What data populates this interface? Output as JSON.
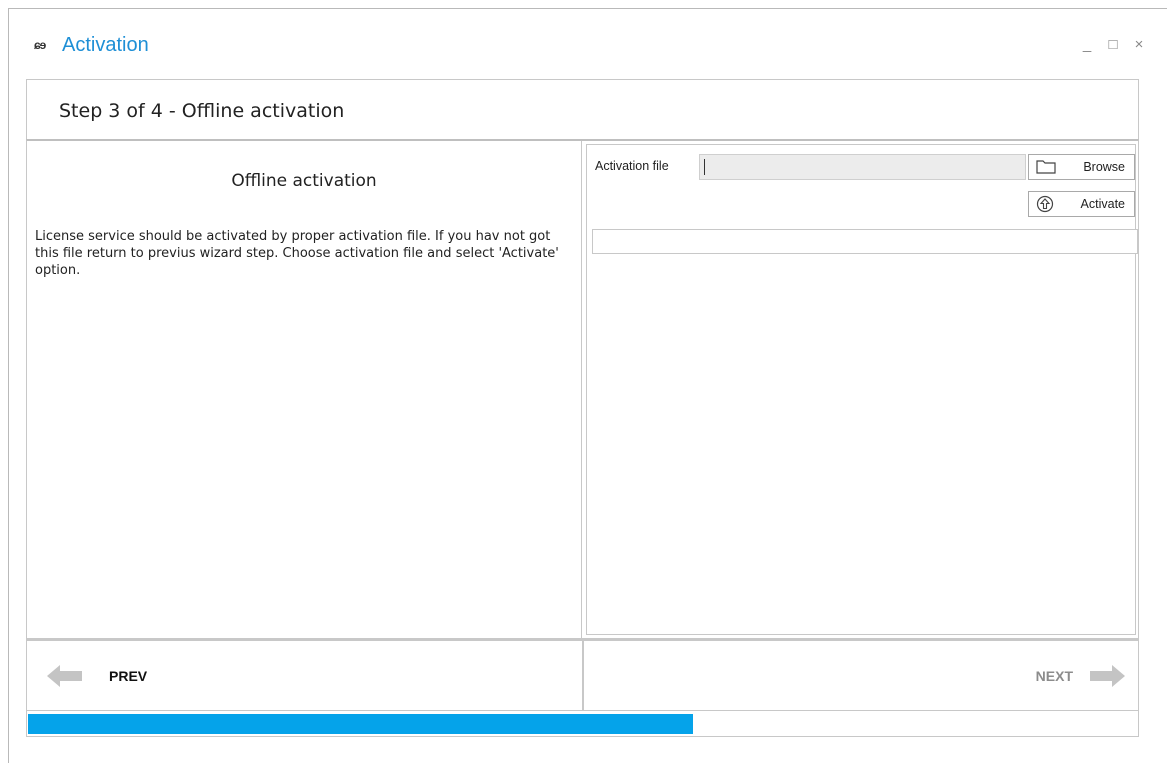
{
  "window": {
    "logo": "ɕɘ",
    "title": "Activation",
    "controls": {
      "minimize": "_",
      "maximize": "□",
      "close": "×"
    }
  },
  "header": {
    "step_title": "Step 3 of 4 - Offline activation"
  },
  "left_pane": {
    "title": "Offline activation",
    "description": "License service should be activated by proper activation file. If you hav not got this file return to previus wizard step. Choose activation file and select 'Activate' option."
  },
  "right_pane": {
    "file_label": "Activation file",
    "file_value": "",
    "browse_label": "Browse",
    "activate_label": "Activate",
    "output_value": ""
  },
  "navigation": {
    "prev_label": "PREV",
    "next_label": "NEXT"
  },
  "progress": {
    "fraction": 0.6
  },
  "colors": {
    "accent": "#1e8fd6",
    "progress": "#05a3ea",
    "arrow_gray": "#c4c4c4"
  },
  "icons": {
    "browse": "folder-icon",
    "activate": "upload-arrow-icon",
    "prev": "arrow-left-icon",
    "next": "arrow-right-icon"
  }
}
